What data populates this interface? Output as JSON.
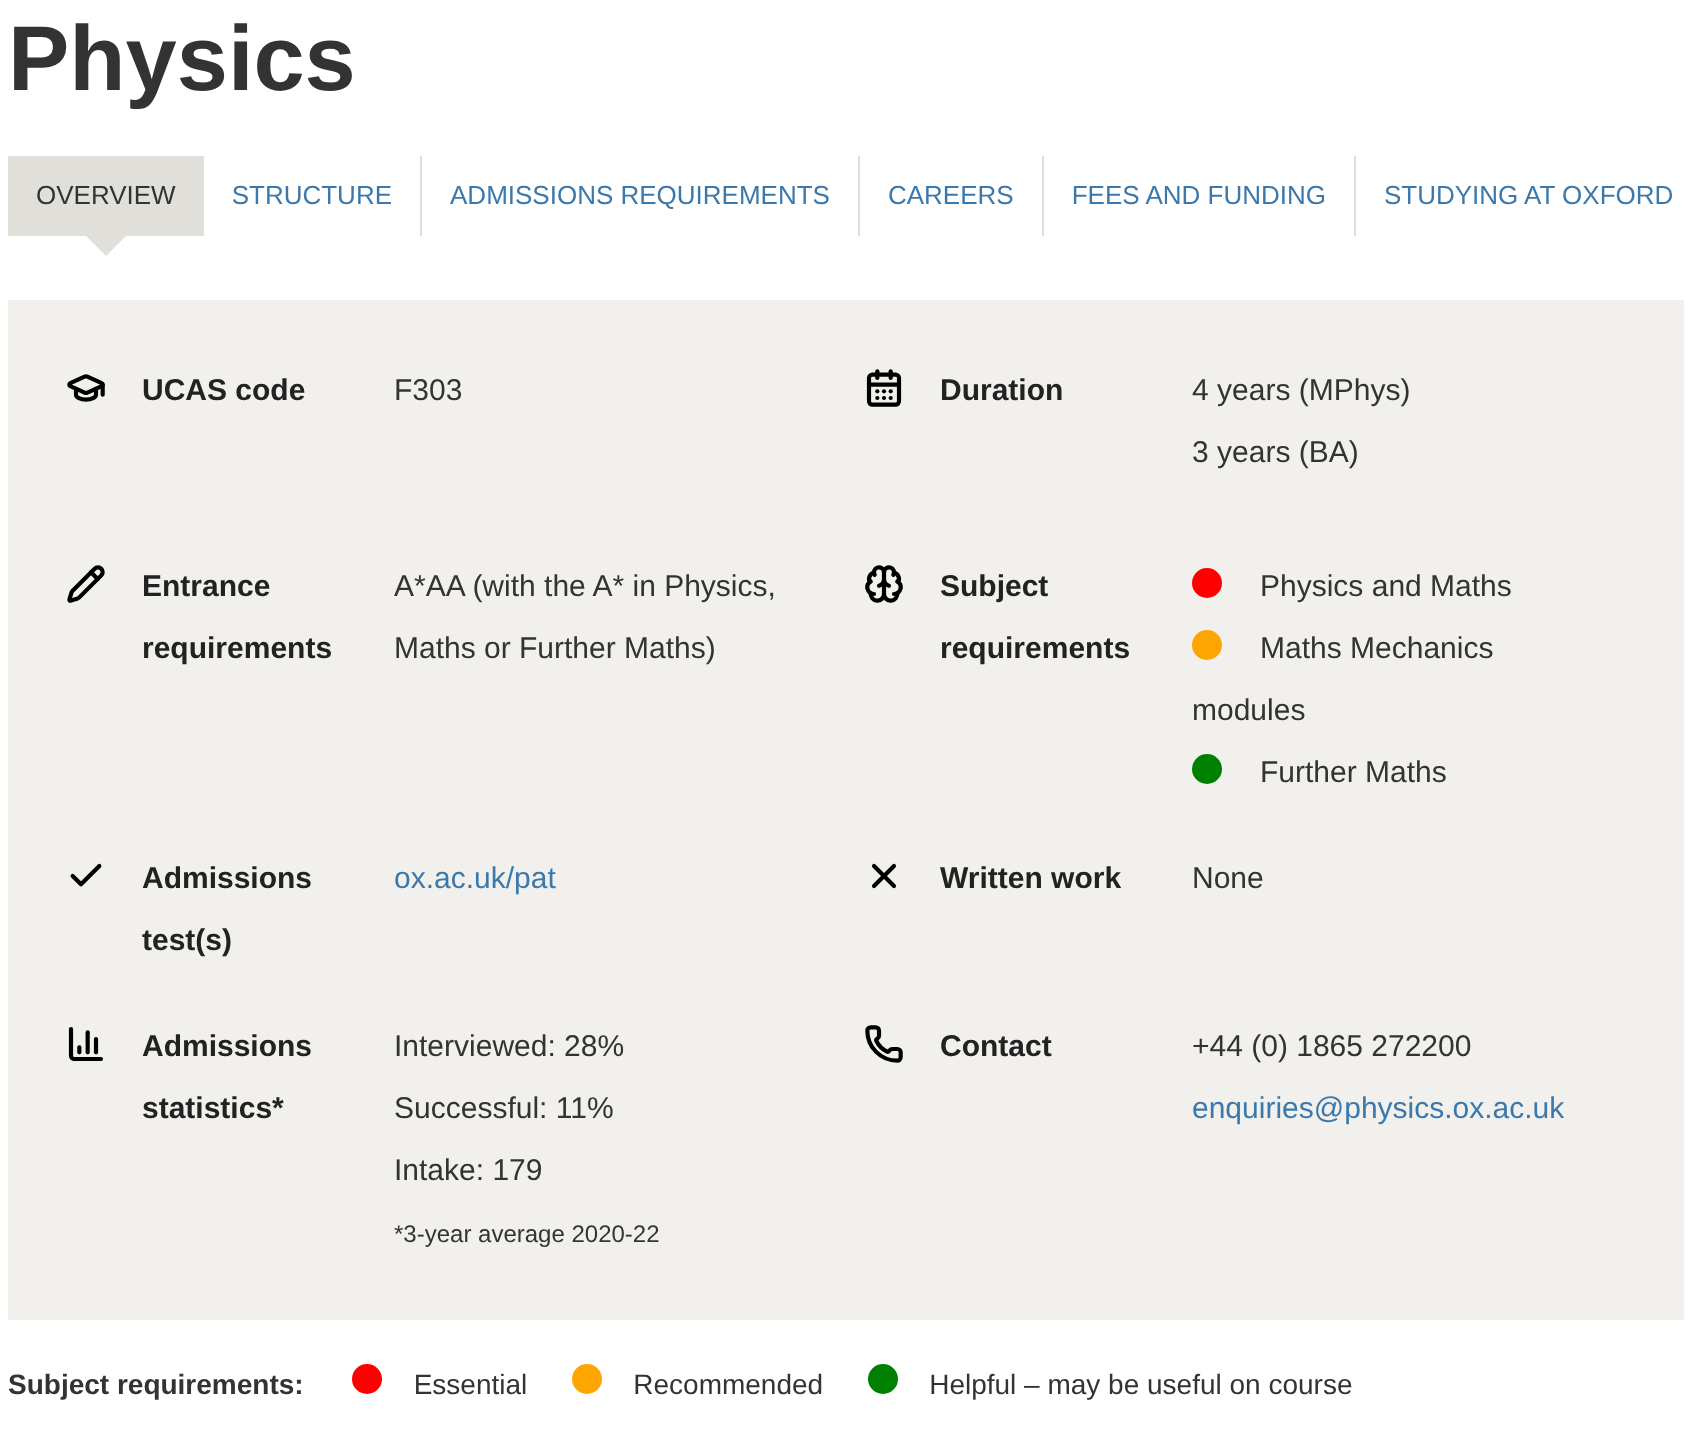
{
  "title": "Physics",
  "tabs": [
    {
      "label": "OVERVIEW",
      "selected": true
    },
    {
      "label": "STRUCTURE",
      "selected": false
    },
    {
      "label": "ADMISSIONS REQUIREMENTS",
      "selected": false
    },
    {
      "label": "CAREERS",
      "selected": false
    },
    {
      "label": "FEES AND FUNDING",
      "selected": false
    },
    {
      "label": "STUDYING AT OXFORD",
      "selected": false
    }
  ],
  "rows": [
    [
      {
        "label": "UCAS code",
        "values": [
          {
            "kind": "text",
            "text": "F303"
          }
        ]
      },
      {
        "label": "Duration",
        "values": [
          {
            "kind": "text",
            "text": "4 years (MPhys)"
          },
          {
            "kind": "text",
            "text": "3 years (BA)"
          }
        ]
      }
    ],
    [
      {
        "label": "Entrance requirements",
        "values": [
          {
            "kind": "text",
            "text": "A*AA (with the A* in Physics, Maths or Further Maths)"
          }
        ]
      },
      {
        "label": "Subject requirements",
        "values": [
          {
            "kind": "dot",
            "text": "Physics and Maths",
            "color": "#ff0000"
          },
          {
            "kind": "dot",
            "text": "Maths Mechanics modules",
            "color": "#ffa500"
          },
          {
            "kind": "dot",
            "text": "Further Maths",
            "color": "#008000"
          }
        ]
      }
    ],
    [
      {
        "label": "Admissions test(s)",
        "values": [
          {
            "kind": "link",
            "text": "ox.ac.uk/pat"
          }
        ]
      },
      {
        "label": "Written work",
        "values": [
          {
            "kind": "text",
            "text": "None"
          }
        ]
      }
    ],
    [
      {
        "label": "Admissions statistics*",
        "values": [
          {
            "kind": "text",
            "text": "Interviewed: 28%"
          },
          {
            "kind": "text",
            "text": "Successful: 11%"
          },
          {
            "kind": "text",
            "text": "Intake: 179"
          },
          {
            "kind": "note",
            "text": "*3-year average 2020-22"
          }
        ]
      },
      {
        "label": "Contact",
        "values": [
          {
            "kind": "text",
            "text": "+44 (0) 1865 272200"
          },
          {
            "kind": "link",
            "text": "enquiries@physics.ox.ac.uk"
          }
        ]
      }
    ]
  ],
  "legend": {
    "label": "Subject requirements:",
    "items": [
      {
        "text": "Essential",
        "color": "#ff0000"
      },
      {
        "text": "Recommended",
        "color": "#ffa500"
      },
      {
        "text": "Helpful – may be useful on course",
        "color": "#008000"
      }
    ]
  }
}
